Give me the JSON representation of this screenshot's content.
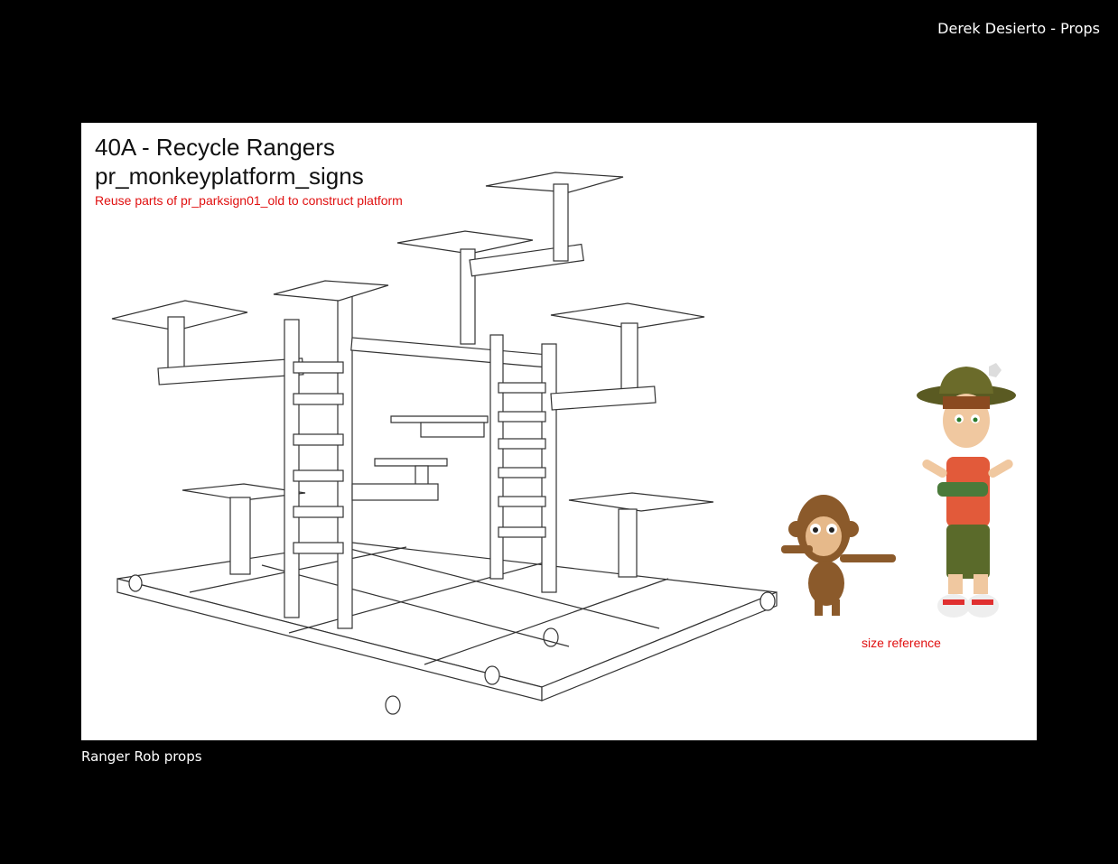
{
  "header": {
    "credit": "Derek Desierto - Props"
  },
  "sheet": {
    "episode_title": "40A - Recycle Rangers",
    "prop_name": "pr_monkeyplatform_signs",
    "note": "Reuse parts of pr_parksign01_old to construct platform",
    "size_reference_label": "size reference"
  },
  "footer": {
    "caption": "Ranger Rob props"
  },
  "colors": {
    "background": "#000000",
    "sheet": "#ffffff",
    "note_red": "#e01010",
    "line": "#333333"
  }
}
